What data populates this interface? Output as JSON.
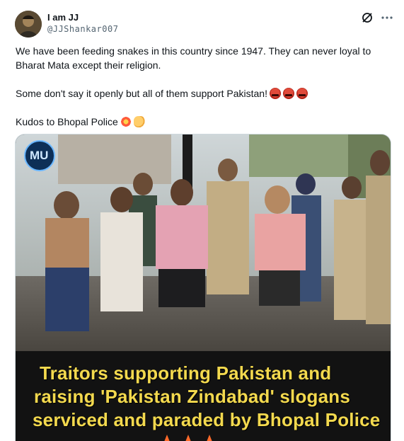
{
  "header": {
    "display_name": "I am JJ",
    "handle": "@JJShankar007",
    "icons": [
      "grok-icon",
      "more-icon"
    ]
  },
  "tweet": {
    "line1": "We have been feeding snakes in this country since 1947. They can never loyal to Bharat Mata except their religion.",
    "line2": "Some don't say it openly but all of them support Pakistan!",
    "line3": "Kudos to Bhopal Police",
    "emojis_line2": [
      "angry-face",
      "angry-face",
      "angry-face"
    ],
    "emojis_line3": [
      "collision",
      "clapping-hands"
    ]
  },
  "media": {
    "logo_text": "MU",
    "caption": [
      "Traitors supporting Pakistan and",
      "raising 'Pakistan Zindabad' slogans",
      "serviced and paraded by Bhopal Police"
    ]
  },
  "colors": {
    "caption_text": "#f3d94e",
    "caption_bg": "#121212",
    "handle": "#536471",
    "text": "#0f1419",
    "border": "#cfd9de"
  }
}
